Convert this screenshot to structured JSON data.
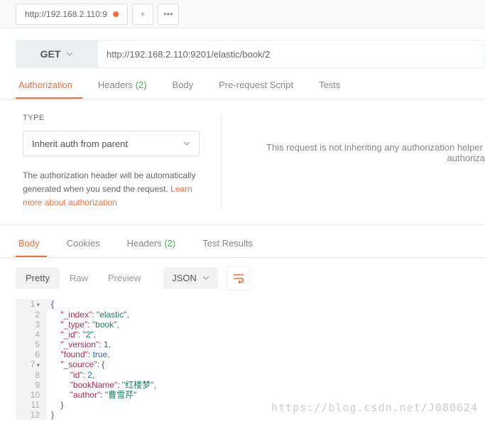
{
  "tab": {
    "title": "http://192.168.2.110:9"
  },
  "method": "GET",
  "url": "http://192.168.2.110:9201/elastic/book/2",
  "reqtabs": {
    "auth": "Authorization",
    "headers": "Headers",
    "headers_count": "(2)",
    "body": "Body",
    "prereq": "Pre-request Script",
    "tests": "Tests"
  },
  "auth": {
    "type_label": "TYPE",
    "selected": "Inherit auth from parent",
    "help1": "The authorization header will be automatically generated when you send the request. ",
    "help_link": "Learn more about authorization",
    "right_msg": "This request is not inheriting any authorization helper",
    "right_msg2": "authoriza"
  },
  "restabs": {
    "body": "Body",
    "cookies": "Cookies",
    "headers": "Headers",
    "headers_count": "(2)",
    "tests": "Test Results"
  },
  "view": {
    "pretty": "Pretty",
    "raw": "Raw",
    "preview": "Preview",
    "format": "JSON"
  },
  "chart_data": {
    "type": "json-response",
    "lines": [
      {
        "n": 1,
        "fold": true,
        "t": [
          {
            "p": "{"
          }
        ]
      },
      {
        "n": 2,
        "t": [
          {
            "pad": "    "
          },
          {
            "k": "\"_index\""
          },
          {
            "p": ": "
          },
          {
            "s": "\"elastic\""
          },
          {
            "p": ","
          }
        ]
      },
      {
        "n": 3,
        "t": [
          {
            "pad": "    "
          },
          {
            "k": "\"_type\""
          },
          {
            "p": ": "
          },
          {
            "s": "\"book\""
          },
          {
            "p": ","
          }
        ]
      },
      {
        "n": 4,
        "t": [
          {
            "pad": "    "
          },
          {
            "k": "\"_id\""
          },
          {
            "p": ": "
          },
          {
            "s": "\"2\""
          },
          {
            "p": ","
          }
        ]
      },
      {
        "n": 5,
        "t": [
          {
            "pad": "    "
          },
          {
            "k": "\"_version\""
          },
          {
            "p": ": "
          },
          {
            "num": "1"
          },
          {
            "p": ","
          }
        ]
      },
      {
        "n": 6,
        "t": [
          {
            "pad": "    "
          },
          {
            "k": "\"found\""
          },
          {
            "p": ": "
          },
          {
            "b": "true"
          },
          {
            "p": ","
          }
        ]
      },
      {
        "n": 7,
        "fold": true,
        "t": [
          {
            "pad": "    "
          },
          {
            "k": "\"_source\""
          },
          {
            "p": ": {"
          }
        ]
      },
      {
        "n": 8,
        "t": [
          {
            "pad": "        "
          },
          {
            "k": "\"id\""
          },
          {
            "p": ": "
          },
          {
            "num": "2"
          },
          {
            "p": ","
          }
        ]
      },
      {
        "n": 9,
        "t": [
          {
            "pad": "        "
          },
          {
            "k": "\"bookName\""
          },
          {
            "p": ": "
          },
          {
            "s": "\"红楼梦\""
          },
          {
            "p": ","
          }
        ]
      },
      {
        "n": 10,
        "t": [
          {
            "pad": "        "
          },
          {
            "k": "\"author\""
          },
          {
            "p": ": "
          },
          {
            "s": "\"曹雪芹\""
          }
        ]
      },
      {
        "n": 11,
        "t": [
          {
            "pad": "    "
          },
          {
            "p": "}"
          }
        ]
      },
      {
        "n": 12,
        "t": [
          {
            "p": "}"
          }
        ]
      }
    ]
  },
  "watermark": "https://blog.csdn.net/J080624"
}
